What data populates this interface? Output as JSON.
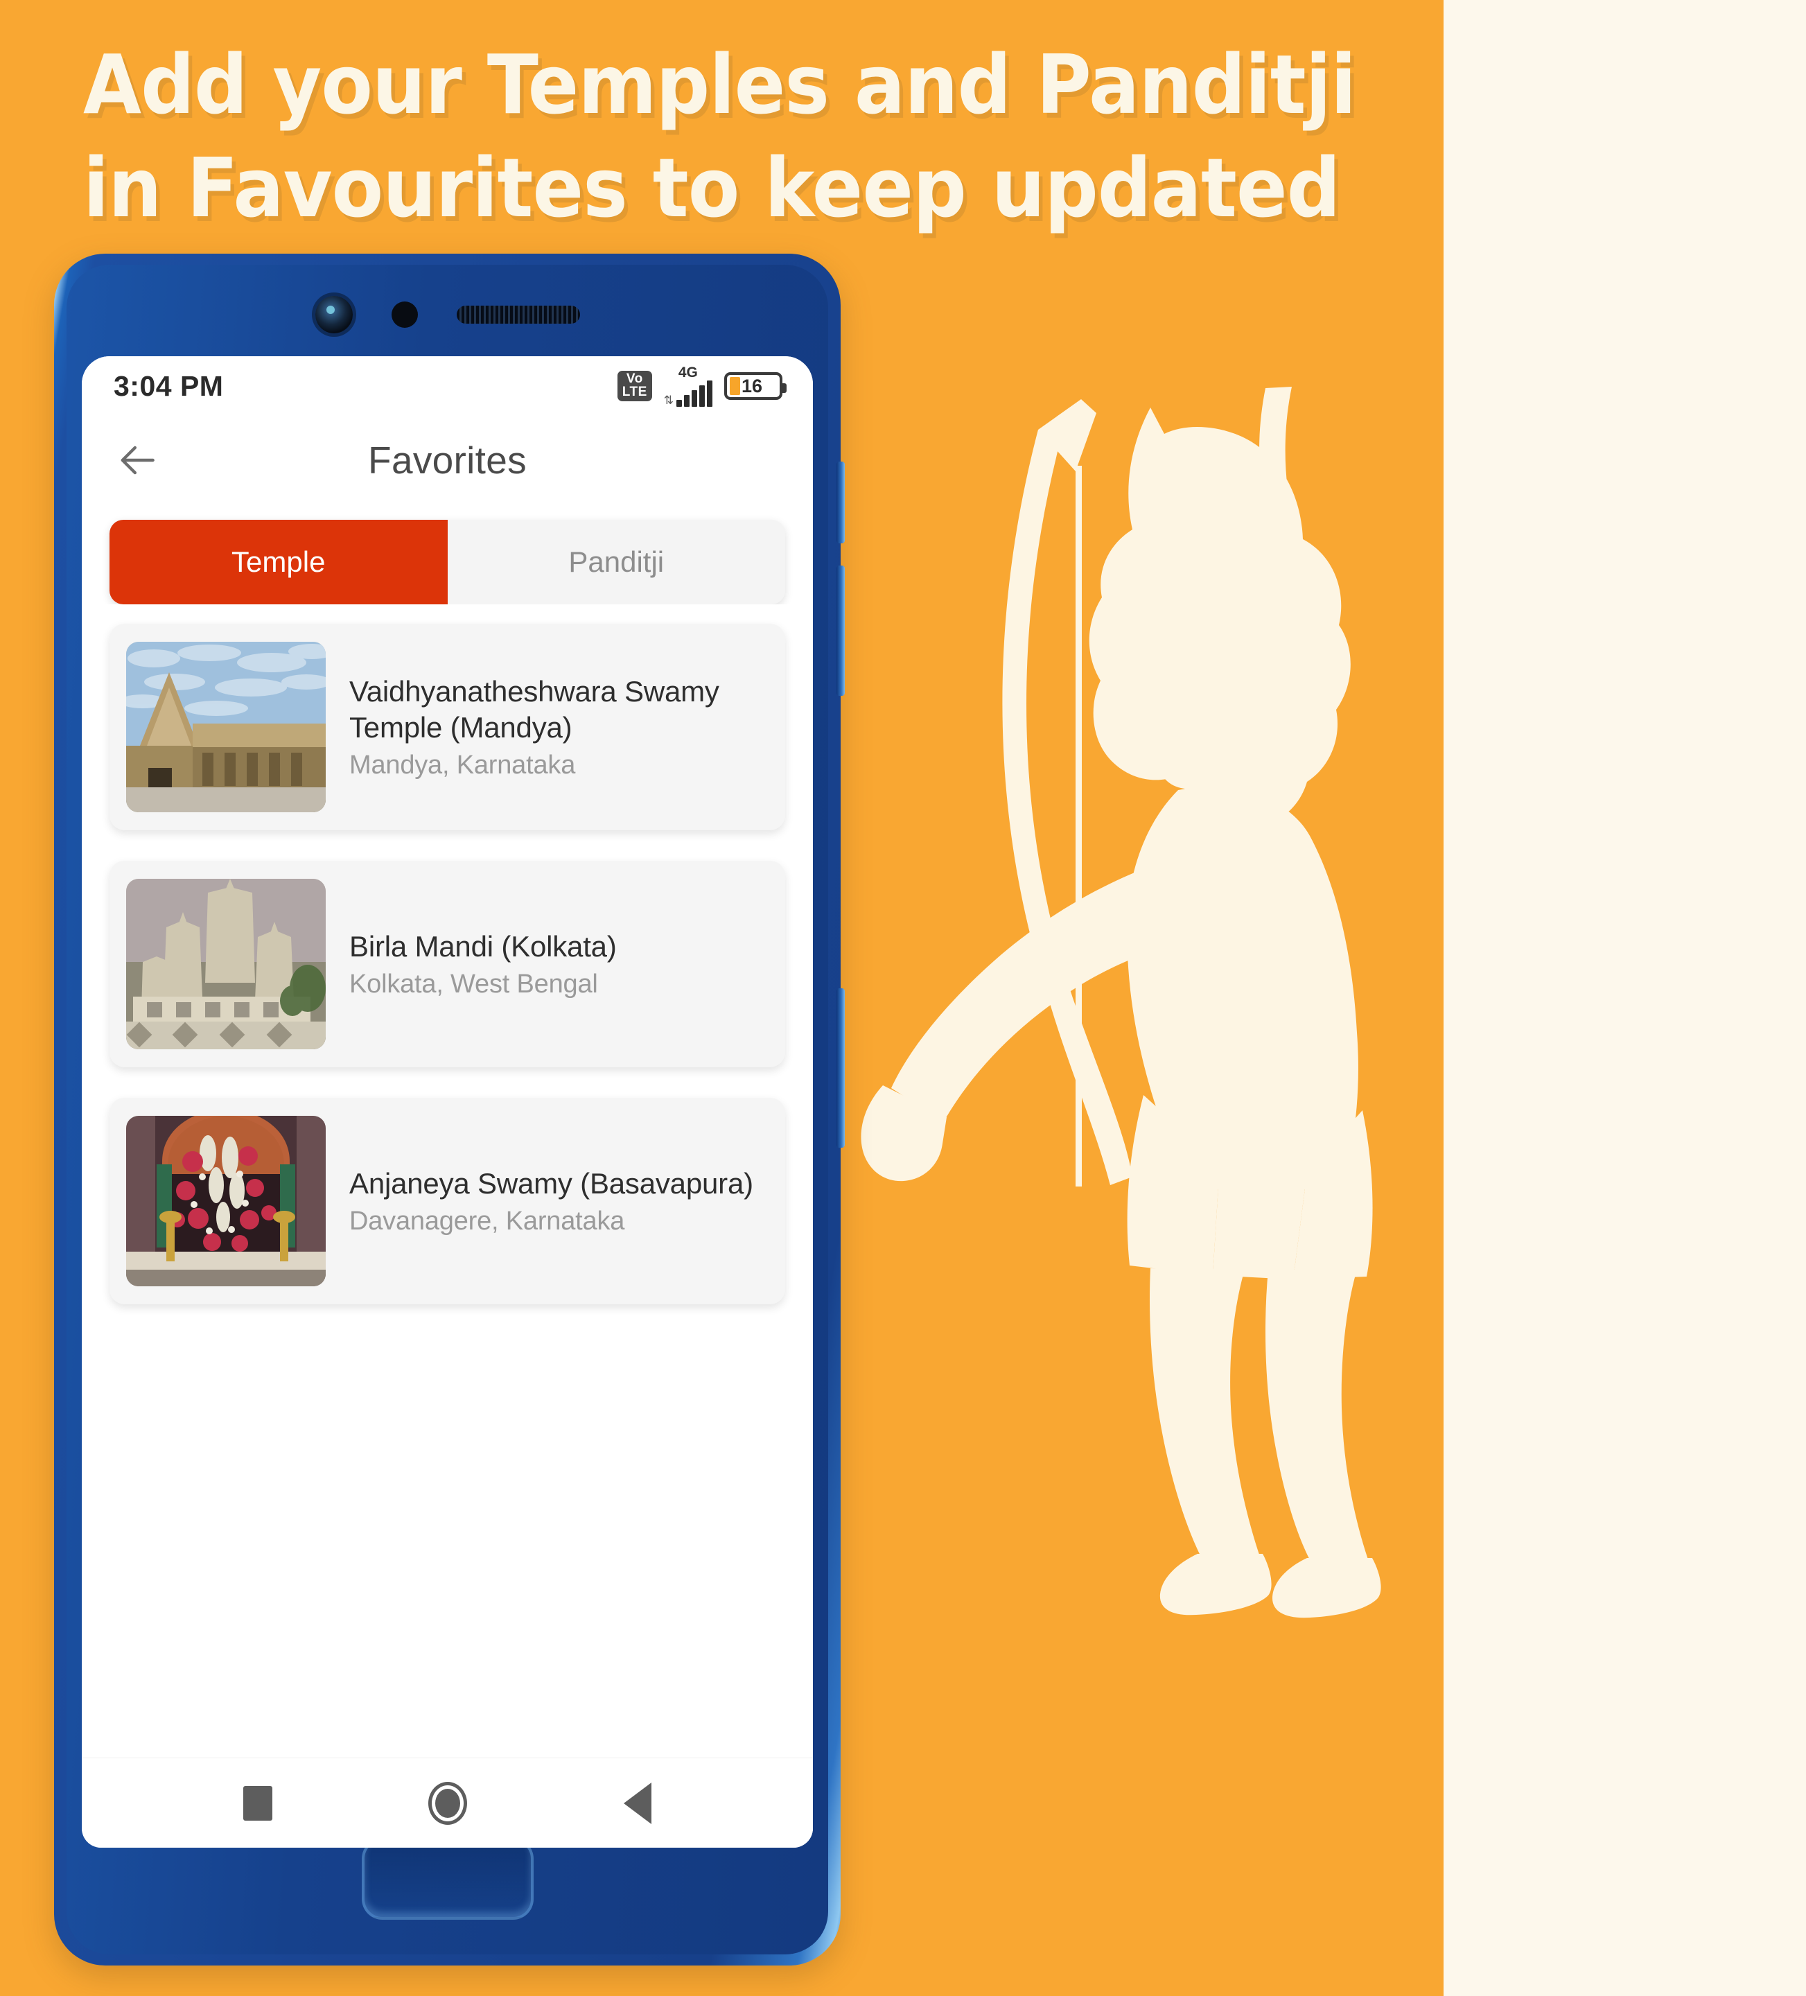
{
  "poster": {
    "headline_line1": "Add your Temples and Panditji",
    "headline_line2": "in Favourites to keep updated",
    "colors": {
      "background_orange": "#F9A732",
      "background_cream": "#FDF8EC",
      "accent_red": "#DC3409",
      "phone_body_blue": "#1A4593"
    },
    "illustration": "rama-with-bow-silhouette"
  },
  "phone": {
    "status_bar": {
      "time": "3:04 PM",
      "volte_line1": "Vo",
      "volte_line2": "LTE",
      "network": "4G",
      "data_arrows": "⇅",
      "battery_level": "16"
    },
    "app_bar": {
      "back_icon": "arrow-left-icon",
      "title": "Favorites"
    },
    "tabs": [
      {
        "label": "Temple",
        "active": true
      },
      {
        "label": "Panditji",
        "active": false
      }
    ],
    "favorites": [
      {
        "name": "Vaidhyanatheshwara Swamy Temple  (Mandya)",
        "location": "Mandya, Karnataka",
        "thumbnail": "stone-temple-gopuram-photo"
      },
      {
        "name": "Birla Mandi  (Kolkata)",
        "location": "Kolkata, West Bengal",
        "thumbnail": "white-marble-temple-photo"
      },
      {
        "name": "Anjaneya Swamy (Basavapura)",
        "location": "Davanagere, Karnataka",
        "thumbnail": "deity-with-flower-garland-photo"
      }
    ],
    "nav_bar": {
      "recents_label": "recents-square-icon",
      "home_label": "home-circle-icon",
      "back_label": "back-triangle-icon"
    }
  }
}
